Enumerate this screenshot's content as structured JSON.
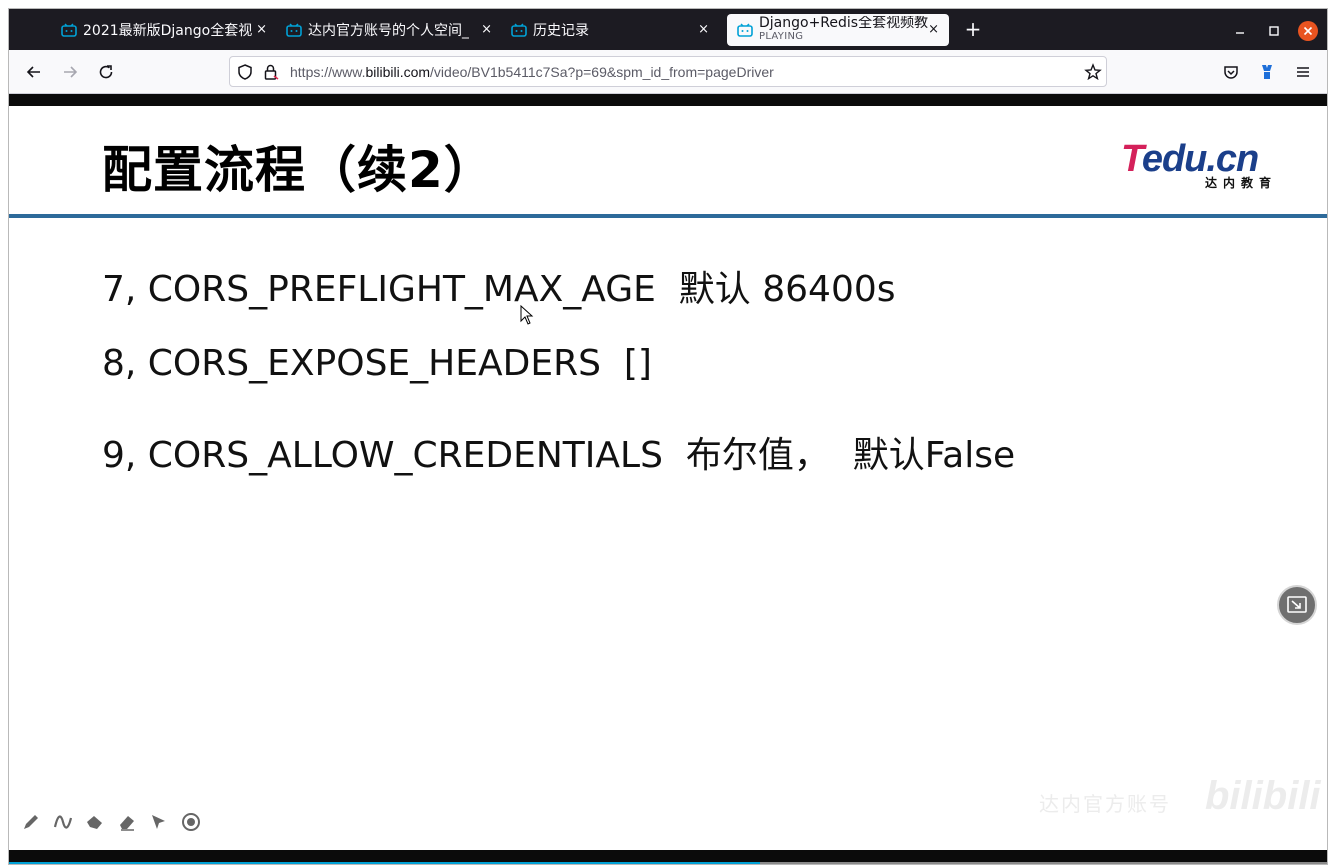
{
  "browser": {
    "tabs": [
      {
        "label": "2021最新版Django全套视",
        "close": "×"
      },
      {
        "label": "达内官方账号的个人空间_",
        "close": "×"
      },
      {
        "label": "历史记录",
        "close": "×"
      },
      {
        "label": "Django+Redis全套视频教",
        "sublabel": "PLAYING",
        "close": "×",
        "active": true
      }
    ],
    "new_tab": "+",
    "url": {
      "prefix": "https://www.",
      "host": "bilibili.com",
      "path": "/video/BV1b5411c7Sa?p=69&spm_id_from=pageDriver"
    }
  },
  "slide": {
    "title": "配置流程（续2）",
    "lines": [
      "7, CORS_PREFLIGHT_MAX_AGE  默认 86400s",
      "8, CORS_EXPOSE_HEADERS  []",
      "9, CORS_ALLOW_CREDENTIALS  布尔值，  默认False"
    ],
    "logo": {
      "brand_t": "T",
      "brand_rest": "edu.cn",
      "subtitle": "达内教育"
    }
  },
  "player": {
    "progress_fraction": 0.57,
    "watermark_text": "达内官方账号",
    "watermark_brand": "bilibili"
  },
  "colors": {
    "tabstrip": "#1c1b22",
    "accent_rule": "#2d6a9a",
    "bilibili_blue": "#00a1d6",
    "close_orange": "#e95420"
  },
  "icons": [
    "bilibili-tab-icon",
    "back-arrow-icon",
    "forward-arrow-icon",
    "reload-icon",
    "shield-icon",
    "lock-icon",
    "star-icon",
    "pocket-icon",
    "extension-icon",
    "menu-icon",
    "pip-icon",
    "pen-icon",
    "curve-icon",
    "highlighter-icon",
    "eraser-icon",
    "pointer-icon",
    "record-icon"
  ]
}
